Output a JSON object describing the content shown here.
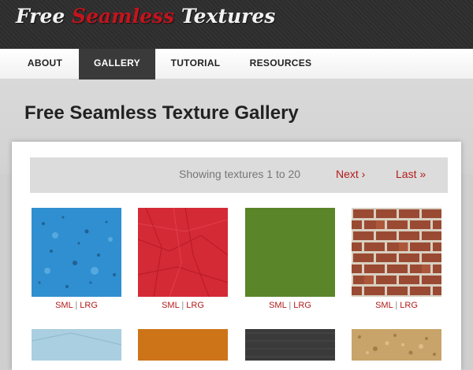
{
  "site": {
    "logo_part1": "Free",
    "logo_part2": "Seamless",
    "logo_part3": "Textures"
  },
  "nav": {
    "items": [
      {
        "label": "ABOUT"
      },
      {
        "label": "GALLERY",
        "active": true
      },
      {
        "label": "TUTORIAL"
      },
      {
        "label": "RESOURCES"
      }
    ]
  },
  "page": {
    "title": "Free Seamless Texture Gallery"
  },
  "pager": {
    "status": "Showing textures 1 to 20",
    "next": "Next ›",
    "last": "Last »"
  },
  "textures": [
    {
      "name": "blue-paint-texture",
      "color": "#2f8fd0",
      "sml": "SML",
      "sep": "|",
      "lrg": "LRG"
    },
    {
      "name": "red-paper-texture",
      "color": "#d42a36",
      "sml": "SML",
      "sep": "|",
      "lrg": "LRG"
    },
    {
      "name": "green-fabric-texture",
      "color": "#5f8a2c",
      "sml": "SML",
      "sep": "|",
      "lrg": "LRG"
    },
    {
      "name": "brick-wall-texture",
      "color": "#9a4a33",
      "sml": "SML",
      "sep": "|",
      "lrg": "LRG"
    },
    {
      "name": "light-blue-paper-texture",
      "color": "#a9cfe0"
    },
    {
      "name": "orange-texture",
      "color": "#c46a12"
    },
    {
      "name": "dark-fabric-texture",
      "color": "#3a3a3a"
    },
    {
      "name": "cork-texture",
      "color": "#c8a46a"
    }
  ],
  "colors": {
    "accent_red": "#b31b1b",
    "header_dark": "#2e2e2e"
  }
}
